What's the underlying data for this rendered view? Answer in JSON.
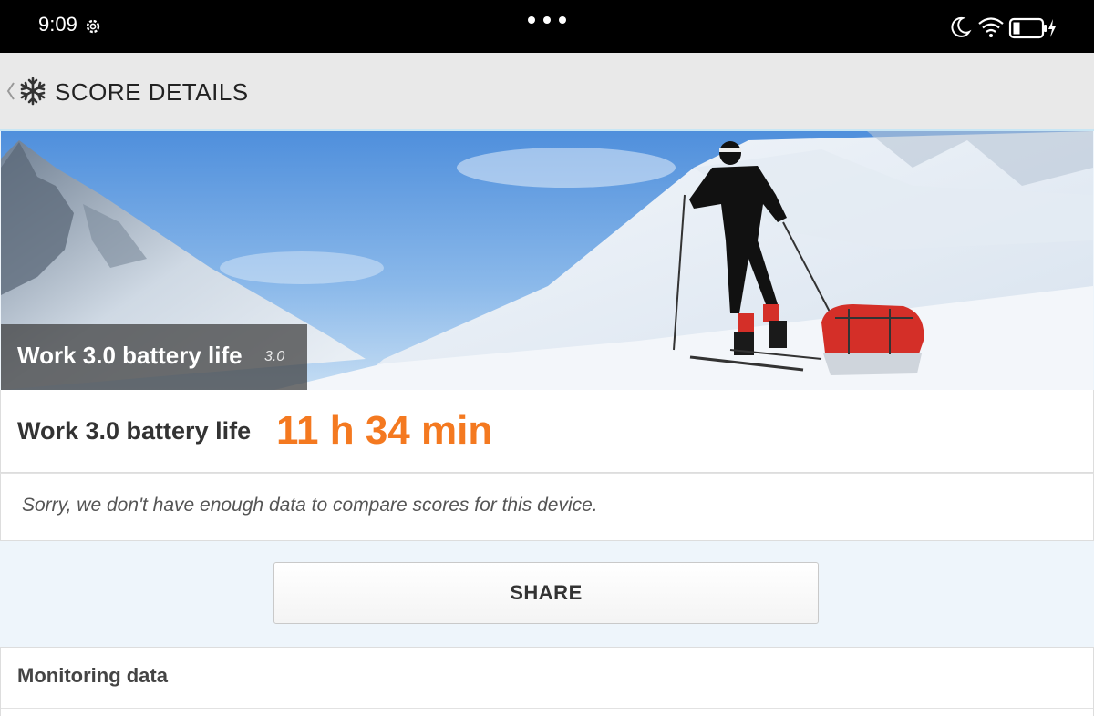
{
  "status_bar": {
    "time": "9:09",
    "icons": [
      "gear-icon",
      "more-dots-icon",
      "moon-icon",
      "wifi-icon",
      "battery-charging-icon"
    ]
  },
  "app_bar": {
    "title": "SCORE DETAILS",
    "icons": [
      "back-chevron-icon",
      "snowflake-icon"
    ]
  },
  "hero": {
    "title": "Work 3.0 battery life",
    "version": "3.0"
  },
  "score": {
    "label": "Work 3.0 battery life",
    "value": "11 h 34 min",
    "value_color": "#f47920"
  },
  "compare": {
    "message": "Sorry, we don't have enough data to compare scores for this device."
  },
  "share": {
    "label": "SHARE"
  },
  "monitoring": {
    "title": "Monitoring data"
  }
}
